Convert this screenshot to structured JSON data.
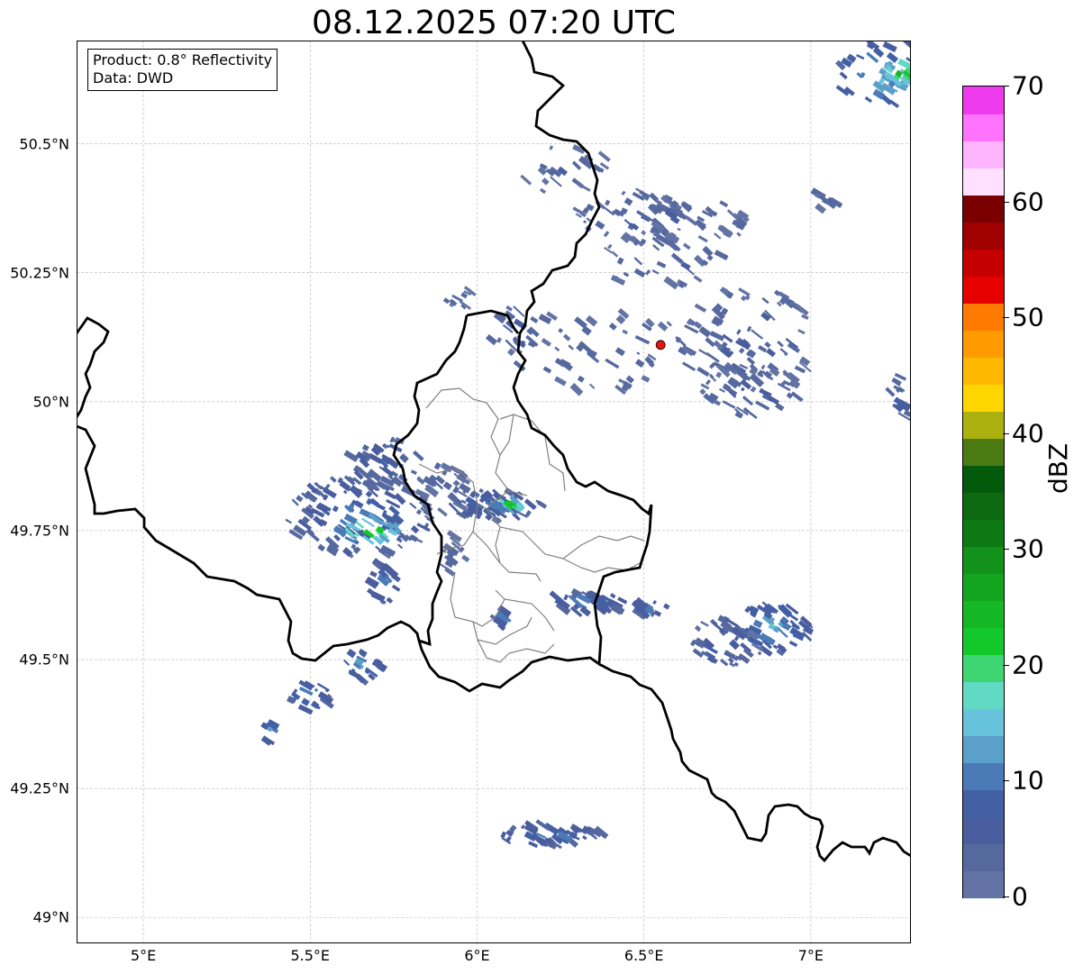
{
  "title": "08.12.2025 07:20 UTC",
  "info": {
    "product": "Product: 0.8° Reflectivity",
    "source": "Data: DWD"
  },
  "map": {
    "extent_lon": [
      4.8,
      7.3
    ],
    "extent_lat": [
      48.95,
      50.7
    ],
    "lat_ticks": [
      {
        "value": 50.5,
        "label": "50.5°N"
      },
      {
        "value": 50.25,
        "label": "50.25°N"
      },
      {
        "value": 50.0,
        "label": "50°N"
      },
      {
        "value": 49.75,
        "label": "49.75°N"
      },
      {
        "value": 49.5,
        "label": "49.5°N"
      },
      {
        "value": 49.25,
        "label": "49.25°N"
      },
      {
        "value": 49.0,
        "label": "49°N"
      }
    ],
    "lon_ticks": [
      {
        "value": 5.0,
        "label": "5°E"
      },
      {
        "value": 5.5,
        "label": "5.5°E"
      },
      {
        "value": 6.0,
        "label": "6°E"
      },
      {
        "value": 6.5,
        "label": "6.5°E"
      },
      {
        "value": 7.0,
        "label": "7°E"
      }
    ],
    "gridlines": true,
    "radar_site": {
      "lon": 6.55,
      "lat": 50.11,
      "color": "#ee1111"
    }
  },
  "colorbar": {
    "label": "dBZ",
    "min": 0,
    "max": 70,
    "step": 2.5,
    "tick_labels": [
      "0",
      "10",
      "20",
      "30",
      "40",
      "50",
      "60",
      "70"
    ],
    "colors": [
      "#6373a4",
      "#56699f",
      "#4a5d9e",
      "#4360a4",
      "#4a7bb6",
      "#5aa0c9",
      "#66c3db",
      "#62d9c3",
      "#3dd672",
      "#12c82a",
      "#14b724",
      "#13a51f",
      "#12921a",
      "#0c7912",
      "#0d6a10",
      "#045a0b",
      "#4a7b12",
      "#adb110",
      "#ffd600",
      "#ffb800",
      "#ff9a00",
      "#ff7a00",
      "#e60000",
      "#c50000",
      "#a10000",
      "#7a0000",
      "#ffe1ff",
      "#ffb4ff",
      "#ff73ff",
      "#ee3bee"
    ]
  },
  "echoes": [
    {
      "lon": 6.47,
      "lat": 50.36,
      "w": 0.18,
      "h": 0.05,
      "dbz": 4,
      "cells": 50
    },
    {
      "lon": 6.64,
      "lat": 50.35,
      "w": 0.18,
      "h": 0.05,
      "dbz": 4,
      "cells": 45
    },
    {
      "lon": 6.55,
      "lat": 50.27,
      "w": 0.2,
      "h": 0.05,
      "dbz": 4,
      "cells": 30
    },
    {
      "lon": 6.27,
      "lat": 50.45,
      "w": 0.15,
      "h": 0.05,
      "dbz": 4,
      "cells": 20
    },
    {
      "lon": 6.82,
      "lat": 50.12,
      "w": 0.2,
      "h": 0.1,
      "dbz": 5,
      "cells": 80
    },
    {
      "lon": 6.82,
      "lat": 50.02,
      "w": 0.15,
      "h": 0.05,
      "dbz": 5,
      "cells": 50
    },
    {
      "lon": 6.38,
      "lat": 50.1,
      "w": 0.35,
      "h": 0.08,
      "dbz": 4,
      "cells": 60
    },
    {
      "lon": 6.12,
      "lat": 50.14,
      "w": 0.06,
      "h": 0.05,
      "dbz": 6,
      "cells": 20
    },
    {
      "lon": 7.24,
      "lat": 50.63,
      "w": 0.16,
      "h": 0.07,
      "dbz": 14,
      "cells": 45
    },
    {
      "lon": 7.27,
      "lat": 50.64,
      "w": 0.06,
      "h": 0.03,
      "dbz": 24,
      "cells": 25
    },
    {
      "lon": 5.65,
      "lat": 49.78,
      "w": 0.22,
      "h": 0.08,
      "dbz": 8,
      "cells": 120
    },
    {
      "lon": 5.68,
      "lat": 49.75,
      "w": 0.1,
      "h": 0.03,
      "dbz": 22,
      "cells": 30
    },
    {
      "lon": 5.72,
      "lat": 49.88,
      "w": 0.12,
      "h": 0.05,
      "dbz": 6,
      "cells": 40
    },
    {
      "lon": 5.72,
      "lat": 49.65,
      "w": 0.05,
      "h": 0.04,
      "dbz": 10,
      "cells": 20
    },
    {
      "lon": 6.05,
      "lat": 49.8,
      "w": 0.15,
      "h": 0.03,
      "dbz": 9,
      "cells": 60
    },
    {
      "lon": 6.1,
      "lat": 49.8,
      "w": 0.05,
      "h": 0.015,
      "dbz": 20,
      "cells": 15
    },
    {
      "lon": 5.9,
      "lat": 49.83,
      "w": 0.08,
      "h": 0.05,
      "dbz": 4,
      "cells": 30
    },
    {
      "lon": 5.93,
      "lat": 49.7,
      "w": 0.04,
      "h": 0.04,
      "dbz": 4,
      "cells": 15
    },
    {
      "lon": 6.33,
      "lat": 49.61,
      "w": 0.12,
      "h": 0.02,
      "dbz": 10,
      "cells": 40
    },
    {
      "lon": 6.52,
      "lat": 49.6,
      "w": 0.06,
      "h": 0.015,
      "dbz": 10,
      "cells": 20
    },
    {
      "lon": 6.88,
      "lat": 49.56,
      "w": 0.12,
      "h": 0.05,
      "dbz": 12,
      "cells": 60
    },
    {
      "lon": 6.74,
      "lat": 49.53,
      "w": 0.1,
      "h": 0.05,
      "dbz": 7,
      "cells": 40
    },
    {
      "lon": 6.22,
      "lat": 49.16,
      "w": 0.16,
      "h": 0.02,
      "dbz": 9,
      "cells": 45
    },
    {
      "lon": 5.5,
      "lat": 49.43,
      "w": 0.06,
      "h": 0.03,
      "dbz": 12,
      "cells": 20
    },
    {
      "lon": 5.66,
      "lat": 49.49,
      "w": 0.06,
      "h": 0.03,
      "dbz": 12,
      "cells": 20
    },
    {
      "lon": 5.38,
      "lat": 49.36,
      "w": 0.02,
      "h": 0.02,
      "dbz": 14,
      "cells": 8
    },
    {
      "lon": 7.27,
      "lat": 50.0,
      "w": 0.05,
      "h": 0.05,
      "dbz": 6,
      "cells": 15
    },
    {
      "lon": 5.95,
      "lat": 50.2,
      "w": 0.05,
      "h": 0.02,
      "dbz": 4,
      "cells": 10
    },
    {
      "lon": 7.05,
      "lat": 50.39,
      "w": 0.04,
      "h": 0.02,
      "dbz": 4,
      "cells": 8
    },
    {
      "lon": 6.08,
      "lat": 49.58,
      "w": 0.03,
      "h": 0.02,
      "dbz": 9,
      "cells": 8
    }
  ]
}
